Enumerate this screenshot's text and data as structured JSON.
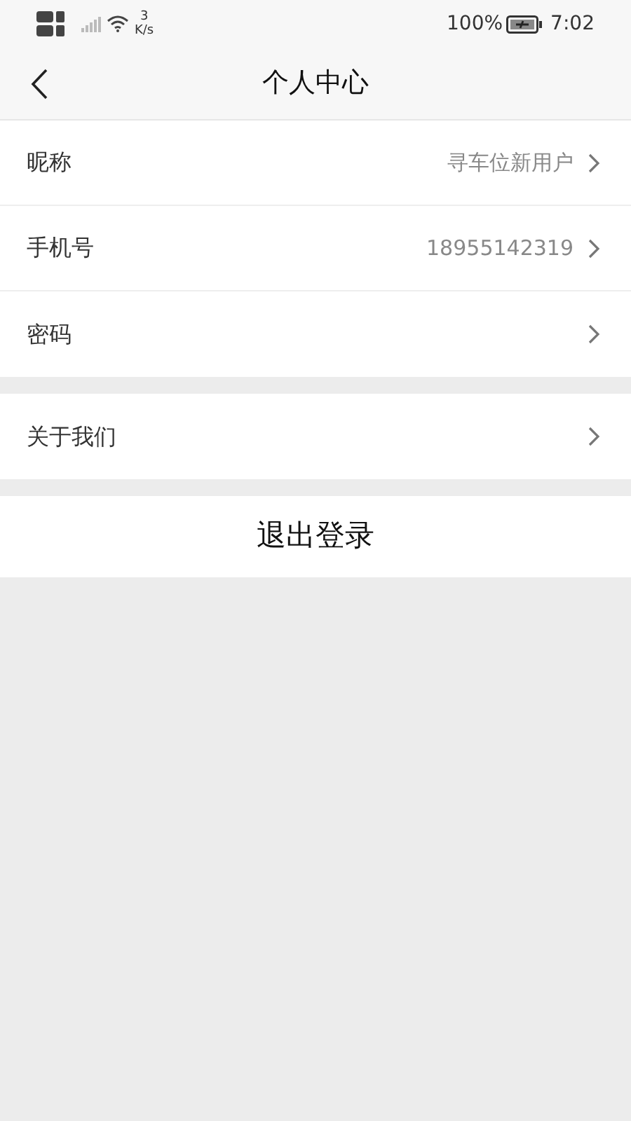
{
  "status_bar": {
    "speed_value": "3",
    "speed_unit": "K/s",
    "battery": "100%",
    "time": "7:02"
  },
  "header": {
    "title": "个人中心"
  },
  "groups": [
    {
      "items": [
        {
          "label": "昵称",
          "value": "寻车位新用户"
        },
        {
          "label": "手机号",
          "value": "18955142319"
        },
        {
          "label": "密码"
        }
      ]
    },
    {
      "items": [
        {
          "label": "关于我们"
        }
      ]
    }
  ],
  "logout_button": "退出登录"
}
